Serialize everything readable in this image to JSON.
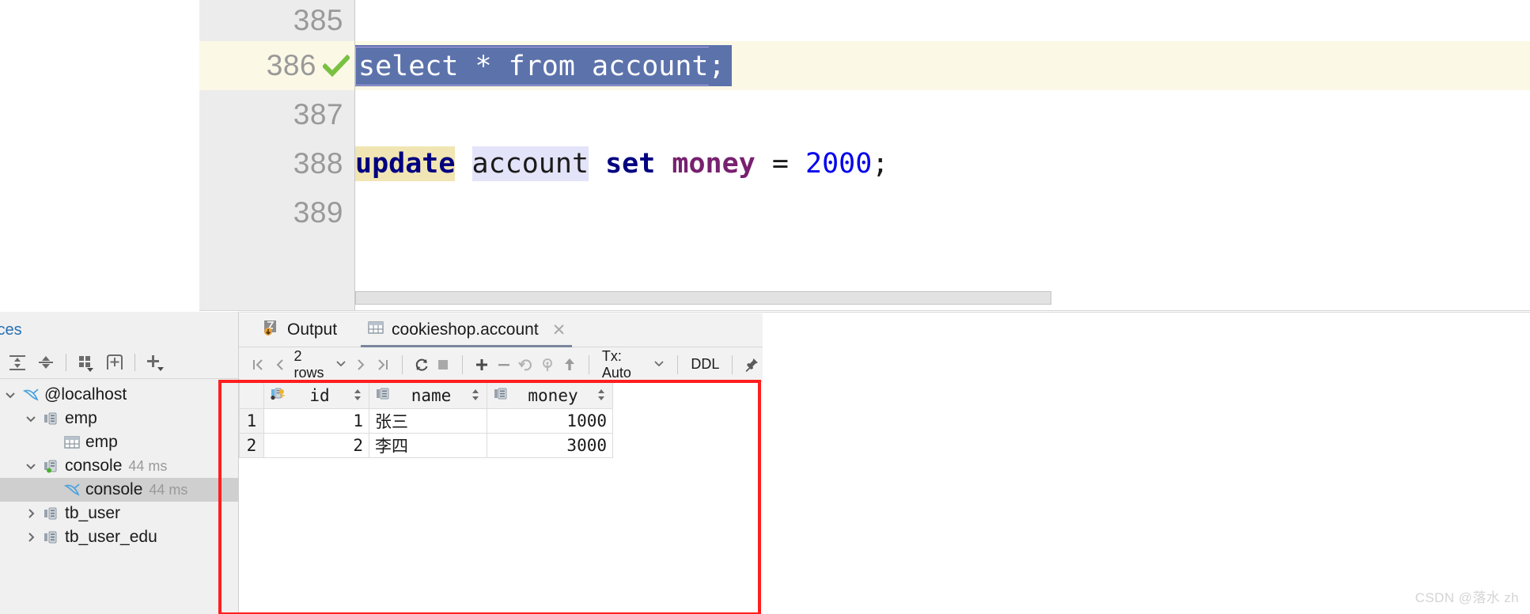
{
  "editor": {
    "lines": [
      {
        "number": "385",
        "executed": false,
        "type": "blank"
      },
      {
        "number": "386",
        "executed": true,
        "type": "select",
        "selected_text": "select * from account",
        "trailing": ";"
      },
      {
        "number": "387",
        "executed": false,
        "type": "blank"
      },
      {
        "number": "388",
        "executed": false,
        "type": "update",
        "tokens": [
          {
            "text": "update",
            "kind": "keyword-highlight"
          },
          {
            "text": " ",
            "kind": "plain"
          },
          {
            "text": "account",
            "kind": "identifier-highlight"
          },
          {
            "text": " ",
            "kind": "plain"
          },
          {
            "text": "set",
            "kind": "keyword"
          },
          {
            "text": " ",
            "kind": "plain"
          },
          {
            "text": "money",
            "kind": "column"
          },
          {
            "text": " ",
            "kind": "plain"
          },
          {
            "text": "=",
            "kind": "plain"
          },
          {
            "text": " ",
            "kind": "plain"
          },
          {
            "text": "2000",
            "kind": "number"
          },
          {
            "text": ";",
            "kind": "plain"
          }
        ]
      },
      {
        "number": "389",
        "executed": false,
        "type": "blank"
      }
    ],
    "execution_marker": "check-mark"
  },
  "sidebar": {
    "title": "ices",
    "toolbar": [
      {
        "name": "expand-all-button",
        "glyph": "expand"
      },
      {
        "name": "collapse-all-button",
        "glyph": "collapse"
      },
      {
        "name": "group-by-button",
        "glyph": "group"
      },
      {
        "name": "new-tab-button",
        "glyph": "newtab"
      },
      {
        "name": "add-button",
        "glyph": "plus"
      }
    ],
    "tree": [
      {
        "label": "@localhost",
        "ms": "",
        "indent": 0,
        "twisty": "down",
        "icon": "dolphin-icon",
        "selected": false
      },
      {
        "label": "emp",
        "ms": "",
        "indent": 1,
        "twisty": "down",
        "icon": "datasource-icon",
        "selected": false
      },
      {
        "label": "emp",
        "ms": "",
        "indent": 2,
        "twisty": "none",
        "icon": "table-icon",
        "selected": false
      },
      {
        "label": "console",
        "ms": "44 ms",
        "indent": 1,
        "twisty": "down",
        "icon": "datasource-green-icon",
        "selected": false
      },
      {
        "label": "console",
        "ms": "44 ms",
        "indent": 2,
        "twisty": "none",
        "icon": "dolphin-icon",
        "selected": true
      },
      {
        "label": "tb_user",
        "ms": "",
        "indent": 1,
        "twisty": "right",
        "icon": "datasource-icon",
        "selected": false
      },
      {
        "label": "tb_user_edu",
        "ms": "",
        "indent": 1,
        "twisty": "right",
        "icon": "datasource-icon",
        "selected": false
      }
    ]
  },
  "results": {
    "tabs": [
      {
        "label": "Output",
        "icon": "output-icon",
        "active": false,
        "closable": false
      },
      {
        "label": "cookieshop.account",
        "icon": "table-icon",
        "active": true,
        "closable": true,
        "close_glyph": "✕"
      }
    ],
    "toolbar": {
      "first_page": "❘❮",
      "prev_page": "❮",
      "rows_label": "2 rows",
      "rows_caret": "∨",
      "next_page": "❯",
      "last_page": "❯❘",
      "reload": "reload-icon",
      "stop": "stop-icon",
      "add_row": "+",
      "delete_row": "−",
      "revert": "revert-icon",
      "revert_selected": "revert-selected-icon",
      "submit": "↑",
      "tx_label": "Tx: Auto",
      "tx_caret": "∨",
      "ddl_label": "DDL",
      "pin": "pin-icon"
    },
    "grid": {
      "columns": [
        {
          "name": "id",
          "icon": "primary-key-icon",
          "align": "right"
        },
        {
          "name": "name",
          "icon": "column-icon",
          "align": "left"
        },
        {
          "name": "money",
          "icon": "column-icon",
          "align": "right"
        }
      ],
      "rows": [
        {
          "n": "1",
          "id": "1",
          "name": "张三",
          "money": "1000"
        },
        {
          "n": "2",
          "id": "2",
          "name": "李四",
          "money": "3000"
        }
      ]
    }
  },
  "annotation": {
    "color": "#ff1f1f"
  },
  "watermark": {
    "text": "CSDN @落水 zh"
  },
  "colors": {
    "selection_bg": "#5c72ab",
    "exec_line_bg": "#fbf8e6",
    "keyword": "#000080",
    "keyword_highlight_bg": "#f1e5b3",
    "identifier_highlight_bg": "#e3e3f9",
    "column": "#77216f",
    "number": "#0000ee",
    "check": "#7ac143"
  }
}
